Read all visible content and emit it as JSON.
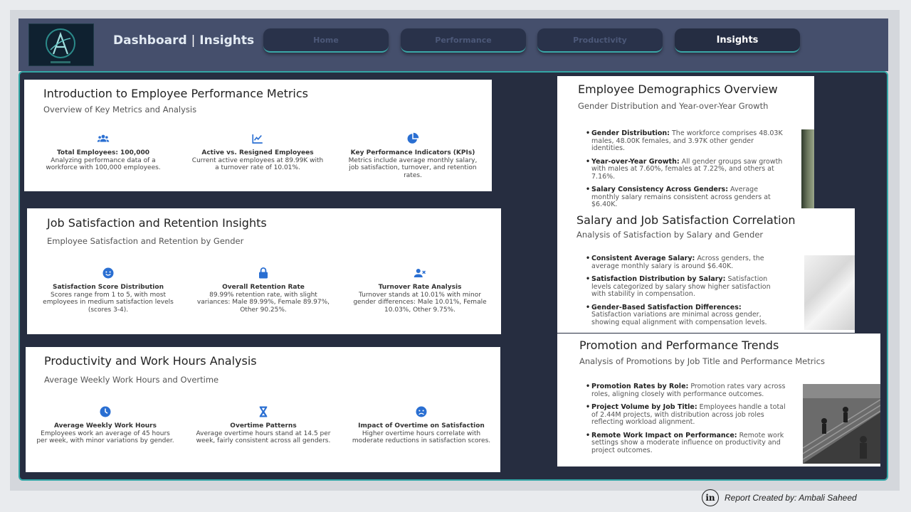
{
  "header": {
    "title_main": "Dashboard",
    "title_sep": "|",
    "title_page": "Insights",
    "nav": [
      {
        "label": "Home",
        "active": false
      },
      {
        "label": "Performance",
        "active": false
      },
      {
        "label": "Productivity",
        "active": false
      },
      {
        "label": "Insights",
        "active": true
      }
    ]
  },
  "cards": {
    "intro": {
      "title": "Introduction to Employee Performance Metrics",
      "subtitle": "Overview of Key Metrics and Analysis",
      "features": [
        {
          "icon": "people-icon",
          "title": "Total Employees: 100,000",
          "text": "Analyzing performance data of a workforce with 100,000 employees."
        },
        {
          "icon": "trend-chart-icon",
          "title": "Active vs. Resigned Employees",
          "text": "Current active employees at 89.99K with a turnover rate of 10.01%."
        },
        {
          "icon": "pie-chart-icon",
          "title": "Key Performance Indicators (KPIs)",
          "text": "Metrics include average monthly salary, job satisfaction, turnover, and retention rates."
        }
      ]
    },
    "satisfaction": {
      "title": "Job Satisfaction and Retention Insights",
      "subtitle": "Employee Satisfaction and Retention by Gender",
      "features": [
        {
          "icon": "smile-icon",
          "title": "Satisfaction Score Distribution",
          "text": "Scores range from 1 to 5, with most employees in medium satisfaction levels (scores 3-4)."
        },
        {
          "icon": "lock-icon",
          "title": "Overall Retention Rate",
          "text": "89.99% retention rate, with slight variances: Male 89.99%, Female 89.97%, Other 90.25%."
        },
        {
          "icon": "user-remove-icon",
          "title": "Turnover Rate Analysis",
          "text": "Turnover stands at 10.01% with minor gender differences: Male 10.01%, Female 10.03%, Other 9.75%."
        }
      ]
    },
    "productivity": {
      "title": "Productivity and Work Hours Analysis",
      "subtitle": "Average Weekly Work Hours and Overtime",
      "features": [
        {
          "icon": "clock-icon",
          "title": "Average Weekly Work Hours",
          "text": "Employees work an average of 45 hours per week, with minor variations by gender."
        },
        {
          "icon": "hourglass-icon",
          "title": "Overtime Patterns",
          "text": "Average overtime hours stand at 14.5 per week, fairly consistent across all genders."
        },
        {
          "icon": "sad-face-icon",
          "title": "Impact of Overtime on Satisfaction",
          "text": "Higher overtime hours correlate with moderate reductions in satisfaction scores."
        }
      ]
    },
    "demographics": {
      "title": "Employee Demographics Overview",
      "subtitle": "Gender Distribution and Year-over-Year Growth",
      "bullets": [
        {
          "bold": "Gender Distribution:",
          "text": " The workforce comprises 48.03K males, 48.00K females, and 3.97K other gender identities."
        },
        {
          "bold": "Year-over-Year Growth:",
          "text": " All gender groups saw growth with males at 7.60%, females at 7.22%, and others at 7.16%."
        },
        {
          "bold": "Salary Consistency Across Genders:",
          "text": " Average monthly salary remains consistent across genders at $6.40K."
        }
      ]
    },
    "salary": {
      "title": "Salary and Job Satisfaction Correlation",
      "subtitle": "Analysis of Satisfaction by Salary and Gender",
      "bullets": [
        {
          "bold": "Consistent Average Salary:",
          "text": " Across genders, the average monthly salary is around $6.40K."
        },
        {
          "bold": "Satisfaction Distribution by Salary:",
          "text": " Satisfaction levels categorized by salary show higher satisfaction with stability in compensation."
        },
        {
          "bold": "Gender-Based Satisfaction Differences:",
          "text": " Satisfaction variations are minimal across gender, showing equal alignment with compensation levels."
        }
      ]
    },
    "promotion": {
      "title": "Promotion and Performance Trends",
      "subtitle": "Analysis of Promotions by Job Title and Performance Metrics",
      "bullets": [
        {
          "bold": "Promotion Rates by Role:",
          "text": " Promotion rates vary across roles, aligning closely with performance outcomes."
        },
        {
          "bold": "Project Volume by Job Title:",
          "text": " Employees handle a total of 2.44M projects, with distribution across job roles reflecting workload alignment."
        },
        {
          "bold": "Remote Work Impact on Performance:",
          "text": " Remote work settings show a moderate influence on productivity and project outcomes."
        }
      ]
    }
  },
  "footer": {
    "icon_letter": "in",
    "credit": "Report Created by: Ambali Saheed"
  },
  "colors": {
    "header_bg": "#454f6c",
    "main_bg": "#262d40",
    "accent_teal": "#33a6a6",
    "icon_blue": "#2a6fd2"
  }
}
